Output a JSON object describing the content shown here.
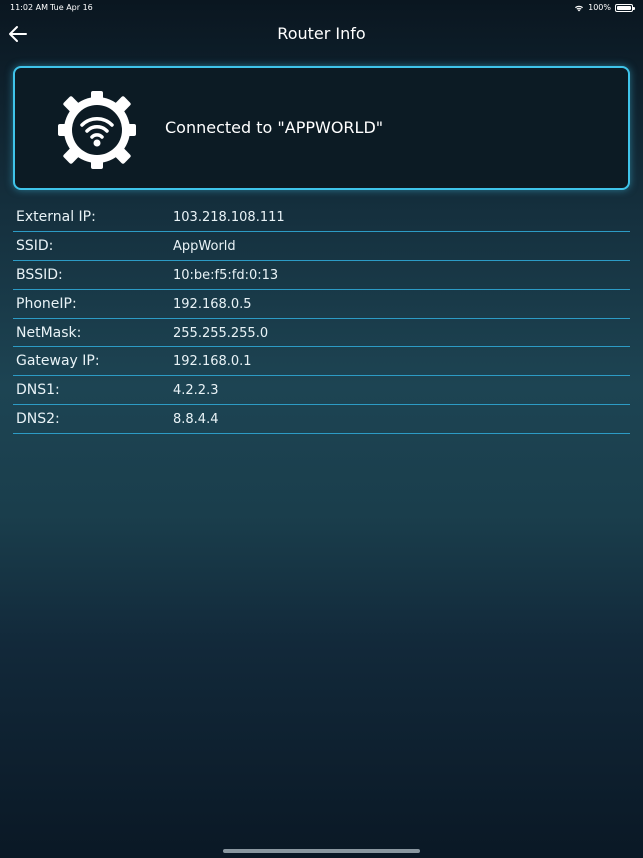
{
  "status_bar": {
    "time": "11:02 AM",
    "date": "Tue Apr 16",
    "battery": "100%"
  },
  "nav": {
    "title": "Router Info",
    "back_icon": "arrow-left-icon"
  },
  "card": {
    "icon": "router-wifi-gear-icon",
    "connected_text": "Connected to \"APPWORLD\""
  },
  "info": [
    {
      "label": "External IP:",
      "value": "103.218.108.111"
    },
    {
      "label": "SSID:",
      "value": "AppWorld"
    },
    {
      "label": "BSSID:",
      "value": "10:be:f5:fd:0:13"
    },
    {
      "label": "PhoneIP:",
      "value": "192.168.0.5"
    },
    {
      "label": "NetMask:",
      "value": "255.255.255.0"
    },
    {
      "label": "Gateway IP:",
      "value": "192.168.0.1"
    },
    {
      "label": "DNS1:",
      "value": "4.2.2.3"
    },
    {
      "label": "DNS2:",
      "value": "8.8.4.4"
    }
  ],
  "colors": {
    "accent": "#3fc4ea",
    "card_bg": "#0c1b24",
    "divider": "#2c9bc5"
  }
}
